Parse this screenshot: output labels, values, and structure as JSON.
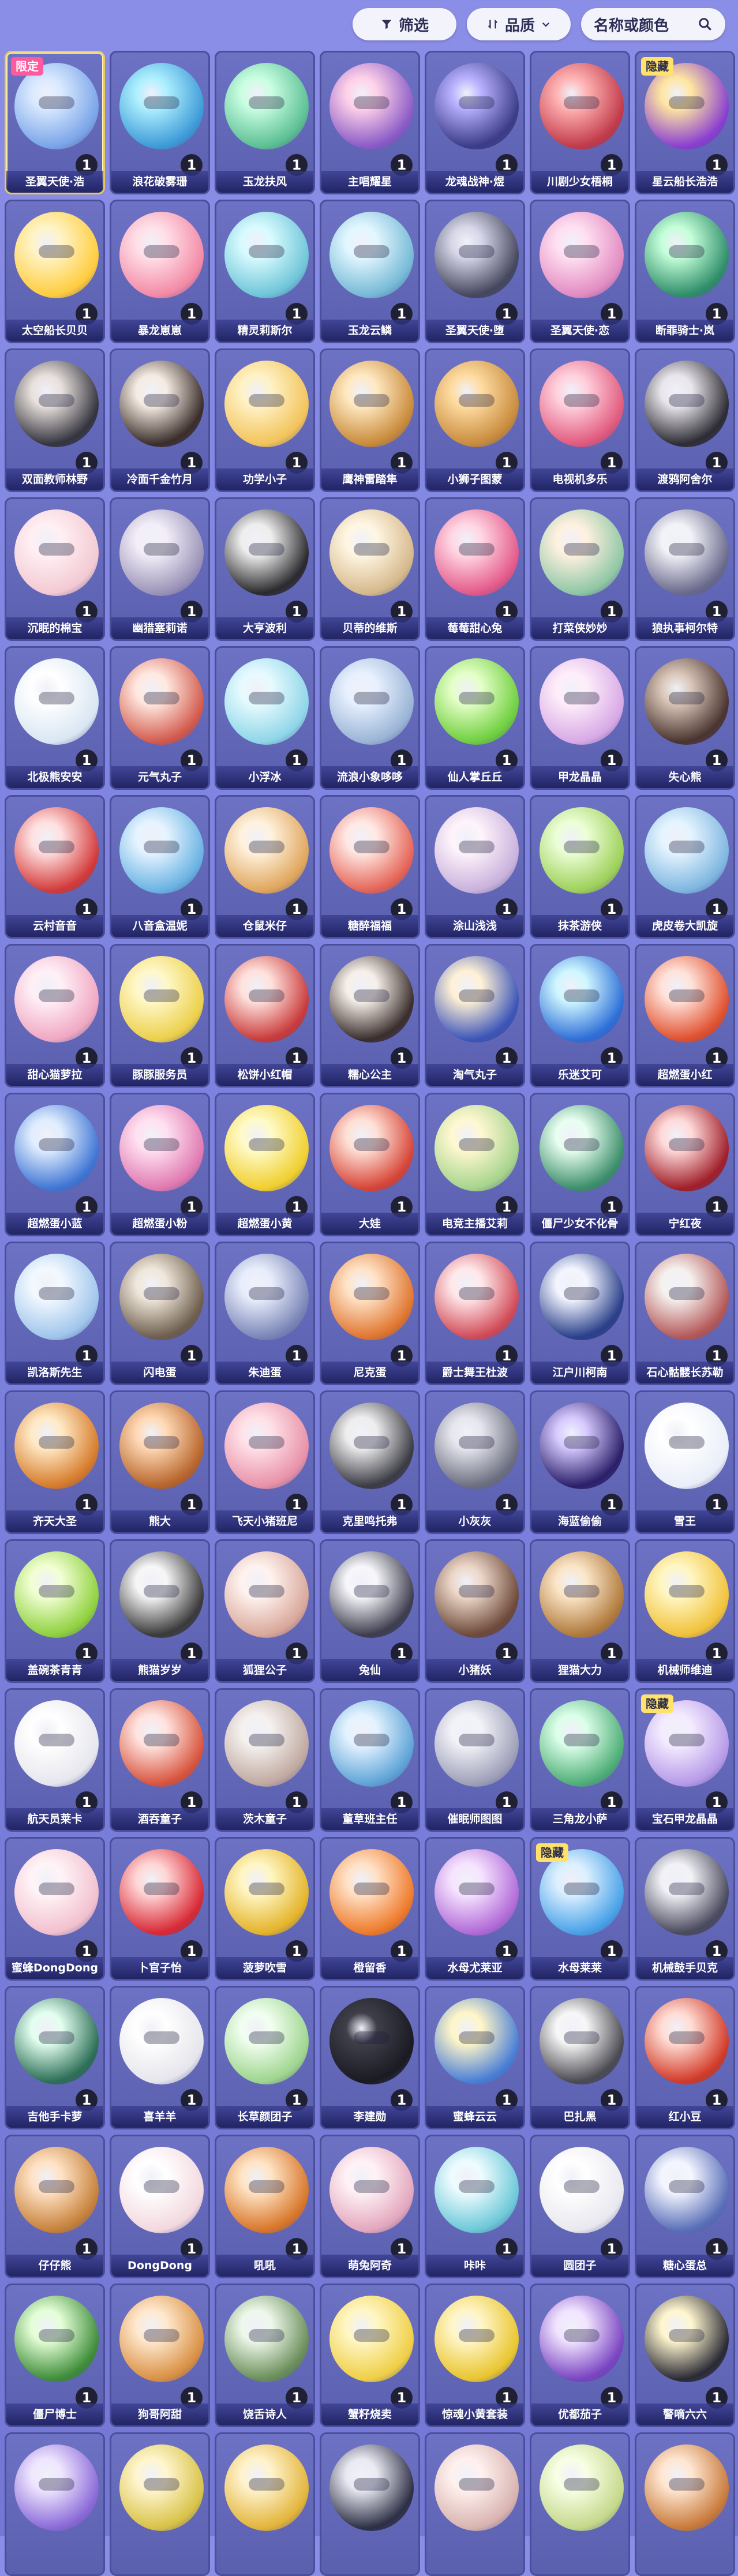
{
  "toolbar": {
    "filter_label": "筛选",
    "quality_label": "品质",
    "search_placeholder": "名称或颜色"
  },
  "cards": [
    {
      "name": "圣翼天使·浩",
      "count": "1",
      "tag": "限定",
      "c1": "#d9e9ff",
      "c2": "#7aa5e8"
    },
    {
      "name": "浪花破雾珊",
      "count": "1",
      "tag": "",
      "c1": "#aef0ff",
      "c2": "#3e9bd8"
    },
    {
      "name": "玉龙扶风",
      "count": "1",
      "tag": "",
      "c1": "#c9ffe2",
      "c2": "#5cbf94"
    },
    {
      "name": "主唱耀星",
      "count": "1",
      "tag": "",
      "c1": "#ffd1e8",
      "c2": "#8a5bc7"
    },
    {
      "name": "龙魂战神·煜",
      "count": "1",
      "tag": "",
      "c1": "#b7b0ff",
      "c2": "#3b3c88"
    },
    {
      "name": "川剧少女梧桐",
      "count": "1",
      "tag": "",
      "c1": "#ffb3b3",
      "c2": "#c23a4a"
    },
    {
      "name": "星云船长浩浩",
      "count": "1",
      "tag": "隐藏",
      "c1": "#ffe6a0",
      "c2": "#8a3fd1"
    },
    {
      "name": "太空船长贝贝",
      "count": "1",
      "tag": "",
      "c1": "#fff4c6",
      "c2": "#ffcc3d"
    },
    {
      "name": "暴龙崽崽",
      "count": "1",
      "tag": "",
      "c1": "#ffe0e8",
      "c2": "#f38aa6"
    },
    {
      "name": "精灵莉斯尔",
      "count": "1",
      "tag": "",
      "c1": "#d8fbff",
      "c2": "#6fc5d8"
    },
    {
      "name": "玉龙云鳞",
      "count": "1",
      "tag": "",
      "c1": "#e2f7ff",
      "c2": "#76b9d6"
    },
    {
      "name": "圣翼天使·堕",
      "count": "1",
      "tag": "",
      "c1": "#d6d6e8",
      "c2": "#45475e"
    },
    {
      "name": "圣翼天使·恋",
      "count": "1",
      "tag": "",
      "c1": "#ffe0f1",
      "c2": "#e28bc2"
    },
    {
      "name": "断罪骑士·岚",
      "count": "1",
      "tag": "",
      "c1": "#c4ffd9",
      "c2": "#2f8e6a"
    },
    {
      "name": "双面教师林野",
      "count": "1",
      "tag": "",
      "c1": "#e8e0dc",
      "c2": "#34343e"
    },
    {
      "name": "冷面千金竹月",
      "count": "1",
      "tag": "",
      "c1": "#f5ece3",
      "c2": "#3a2d2a"
    },
    {
      "name": "功学小子",
      "count": "1",
      "tag": "",
      "c1": "#fff2c6",
      "c2": "#f2c35a"
    },
    {
      "name": "鹰神雷踏隼",
      "count": "1",
      "tag": "",
      "c1": "#ffe9c2",
      "c2": "#c98a3a"
    },
    {
      "name": "小狮子图蒙",
      "count": "1",
      "tag": "",
      "c1": "#ffdca1",
      "c2": "#c88b3d"
    },
    {
      "name": "电视机多乐",
      "count": "1",
      "tag": "",
      "c1": "#ffd1de",
      "c2": "#e15a7d"
    },
    {
      "name": "渡鸦阿舍尔",
      "count": "1",
      "tag": "",
      "c1": "#e9e6ec",
      "c2": "#2d2b33"
    },
    {
      "name": "沉眠的棉宝",
      "count": "1",
      "tag": "",
      "c1": "#fff0f3",
      "c2": "#f3c9d3"
    },
    {
      "name": "幽猎塞莉诺",
      "count": "1",
      "tag": "",
      "c1": "#f3eef8",
      "c2": "#9c94b8"
    },
    {
      "name": "大亨波利",
      "count": "1",
      "tag": "",
      "c1": "#eeeeee",
      "c2": "#2a2a2e"
    },
    {
      "name": "贝蒂的维斯",
      "count": "1",
      "tag": "",
      "c1": "#fff7e3",
      "c2": "#d6b98c"
    },
    {
      "name": "莓莓甜心兔",
      "count": "1",
      "tag": "",
      "c1": "#ffd7e4",
      "c2": "#e45a8a"
    },
    {
      "name": "打菜侠妙妙",
      "count": "1",
      "tag": "",
      "c1": "#fff1e0",
      "c2": "#8fc7a5"
    },
    {
      "name": "狼执事柯尔特",
      "count": "1",
      "tag": "",
      "c1": "#f2f2f8",
      "c2": "#6a6a8c"
    },
    {
      "name": "北极熊安安",
      "count": "1",
      "tag": "",
      "c1": "#ffffff",
      "c2": "#d9e6f3"
    },
    {
      "name": "元气丸子",
      "count": "1",
      "tag": "",
      "c1": "#ffe9e0",
      "c2": "#d35a4d"
    },
    {
      "name": "小浮冰",
      "count": "1",
      "tag": "",
      "c1": "#e7fbff",
      "c2": "#8fd6e8"
    },
    {
      "name": "流浪小象哆哆",
      "count": "1",
      "tag": "",
      "c1": "#e8f1ff",
      "c2": "#9ab4d6"
    },
    {
      "name": "仙人掌丘丘",
      "count": "1",
      "tag": "",
      "c1": "#e4ffc7",
      "c2": "#6fcf3e"
    },
    {
      "name": "甲龙晶晶",
      "count": "1",
      "tag": "",
      "c1": "#ffeefa",
      "c2": "#d7a9e6"
    },
    {
      "name": "失心熊",
      "count": "1",
      "tag": "",
      "c1": "#d9c6b8",
      "c2": "#4a3430"
    },
    {
      "name": "云村音音",
      "count": "1",
      "tag": "",
      "c1": "#ffe0e0",
      "c2": "#d33a3a"
    },
    {
      "name": "八音盒温妮",
      "count": "1",
      "tag": "",
      "c1": "#e6f4ff",
      "c2": "#6ab3e3"
    },
    {
      "name": "仓鼠米仔",
      "count": "1",
      "tag": "",
      "c1": "#fff2de",
      "c2": "#e0a65c"
    },
    {
      "name": "糖醉福福",
      "count": "1",
      "tag": "",
      "c1": "#ffe9e4",
      "c2": "#e56457"
    },
    {
      "name": "涂山浅浅",
      "count": "1",
      "tag": "",
      "c1": "#fff4fb",
      "c2": "#c9b1dc"
    },
    {
      "name": "抹茶游侠",
      "count": "1",
      "tag": "",
      "c1": "#ecffd7",
      "c2": "#9ed05a"
    },
    {
      "name": "虎皮卷大凯旋",
      "count": "1",
      "tag": "",
      "c1": "#e4f4ff",
      "c2": "#7fb6e0"
    },
    {
      "name": "甜心猫萝拉",
      "count": "1",
      "tag": "",
      "c1": "#fff0f6",
      "c2": "#f0a7c3"
    },
    {
      "name": "豚豚服务员",
      "count": "1",
      "tag": "",
      "c1": "#fff8c9",
      "c2": "#ecd04b"
    },
    {
      "name": "松饼小红帽",
      "count": "1",
      "tag": "",
      "c1": "#ffe1dc",
      "c2": "#c93b3b"
    },
    {
      "name": "糯心公主",
      "count": "1",
      "tag": "",
      "c1": "#f6efe9",
      "c2": "#3a2e2c"
    },
    {
      "name": "淘气丸子",
      "count": "1",
      "tag": "",
      "c1": "#fff1d5",
      "c2": "#3c55b8"
    },
    {
      "name": "乐迷艾可",
      "count": "1",
      "tag": "",
      "c1": "#cff7ff",
      "c2": "#2e6fd8"
    },
    {
      "name": "超燃蛋小红",
      "count": "1",
      "tag": "",
      "c1": "#ffe2d9",
      "c2": "#e0502e"
    },
    {
      "name": "超燃蛋小蓝",
      "count": "1",
      "tag": "",
      "c1": "#e0edff",
      "c2": "#4076d4"
    },
    {
      "name": "超燃蛋小粉",
      "count": "1",
      "tag": "",
      "c1": "#ffe1f1",
      "c2": "#e07ab1"
    },
    {
      "name": "超燃蛋小黄",
      "count": "1",
      "tag": "",
      "c1": "#fffbc9",
      "c2": "#f0cf2e"
    },
    {
      "name": "大娃",
      "count": "1",
      "tag": "",
      "c1": "#ffe1d7",
      "c2": "#d64537"
    },
    {
      "name": "电竞主播艾莉",
      "count": "1",
      "tag": "",
      "c1": "#fff8d1",
      "c2": "#a6d48c"
    },
    {
      "name": "僵尸少女不化骨",
      "count": "1",
      "tag": "",
      "c1": "#e9fff1",
      "c2": "#3d8f6b"
    },
    {
      "name": "宁红夜",
      "count": "1",
      "tag": "",
      "c1": "#ffdada",
      "c2": "#a01f2a"
    },
    {
      "name": "凯洛斯先生",
      "count": "1",
      "tag": "",
      "c1": "#f3f9ff",
      "c2": "#9fc5ec"
    },
    {
      "name": "闪电蛋",
      "count": "1",
      "tag": "",
      "c1": "#efe7da",
      "c2": "#6e5e4e"
    },
    {
      "name": "朱迪蛋",
      "count": "1",
      "tag": "",
      "c1": "#e9eefc",
      "c2": "#7b86b8"
    },
    {
      "name": "尼克蛋",
      "count": "1",
      "tag": "",
      "c1": "#ffe3c7",
      "c2": "#e0752f"
    },
    {
      "name": "爵士舞王杜波",
      "count": "1",
      "tag": "",
      "c1": "#ffe8ea",
      "c2": "#d14b58"
    },
    {
      "name": "江户川柯南",
      "count": "1",
      "tag": "",
      "c1": "#f3f6ff",
      "c2": "#2a3f8a"
    },
    {
      "name": "石心骷髅长苏勒",
      "count": "1",
      "tag": "",
      "c1": "#f5f1ee",
      "c2": "#b45858"
    },
    {
      "name": "齐天大圣",
      "count": "1",
      "tag": "",
      "c1": "#ffeac6",
      "c2": "#d67b2a"
    },
    {
      "name": "熊大",
      "count": "1",
      "tag": "",
      "c1": "#ffd9b5",
      "c2": "#b8652b"
    },
    {
      "name": "飞天小猪班尼",
      "count": "1",
      "tag": "",
      "c1": "#ffe1e8",
      "c2": "#e891a8"
    },
    {
      "name": "克里鸣托弗",
      "count": "1",
      "tag": "",
      "c1": "#eeeeee",
      "c2": "#3b3b44"
    },
    {
      "name": "小灰灰",
      "count": "1",
      "tag": "",
      "c1": "#e6e6ee",
      "c2": "#6c6f80"
    },
    {
      "name": "海蓝偷偷",
      "count": "1",
      "tag": "",
      "c1": "#d6c9ff",
      "c2": "#2b1f6a"
    },
    {
      "name": "雪王",
      "count": "1",
      "tag": "",
      "c1": "#ffffff",
      "c2": "#e9eef8"
    },
    {
      "name": "盖碗茶青青",
      "count": "1",
      "tag": "",
      "c1": "#f2ffd4",
      "c2": "#8fd13e"
    },
    {
      "name": "熊猫岁岁",
      "count": "1",
      "tag": "",
      "c1": "#f7f7f7",
      "c2": "#3a3a3a"
    },
    {
      "name": "狐狸公子",
      "count": "1",
      "tag": "",
      "c1": "#fff3ef",
      "c2": "#d9a79a"
    },
    {
      "name": "兔仙",
      "count": "1",
      "tag": "",
      "c1": "#f7f7fb",
      "c2": "#3d3d4e"
    },
    {
      "name": "小猪妖",
      "count": "1",
      "tag": "",
      "c1": "#ecd7c9",
      "c2": "#6e4a3a"
    },
    {
      "name": "狸猫大力",
      "count": "1",
      "tag": "",
      "c1": "#fbe6c8",
      "c2": "#b07a3c"
    },
    {
      "name": "机械师维迪",
      "count": "1",
      "tag": "",
      "c1": "#fff7c4",
      "c2": "#f1c23a"
    },
    {
      "name": "航天员莱卡",
      "count": "1",
      "tag": "",
      "c1": "#ffffff",
      "c2": "#e6e6ee"
    },
    {
      "name": "酒吞童子",
      "count": "1",
      "tag": "",
      "c1": "#ffe4e0",
      "c2": "#d8553e"
    },
    {
      "name": "茨木童子",
      "count": "1",
      "tag": "",
      "c1": "#f4f1ef",
      "c2": "#c0a9a0"
    },
    {
      "name": "董草班主任",
      "count": "1",
      "tag": "",
      "c1": "#e4f3ff",
      "c2": "#5fa4d8"
    },
    {
      "name": "催眠师图图",
      "count": "1",
      "tag": "",
      "c1": "#f2f2f8",
      "c2": "#9ea0b8"
    },
    {
      "name": "三角龙小萨",
      "count": "1",
      "tag": "",
      "c1": "#dcffe9",
      "c2": "#4fae78"
    },
    {
      "name": "宝石甲龙晶晶",
      "count": "1",
      "tag": "隐藏",
      "c1": "#f4ecff",
      "c2": "#b79ae8"
    },
    {
      "name": "蜜蜂DongDong",
      "count": "1",
      "tag": "",
      "c1": "#fff4f7",
      "c2": "#f2c0cf"
    },
    {
      "name": "卜官子怡",
      "count": "1",
      "tag": "",
      "c1": "#ffd6d6",
      "c2": "#d82a35"
    },
    {
      "name": "菠萝吹雪",
      "count": "1",
      "tag": "",
      "c1": "#fff6c4",
      "c2": "#e4b42a"
    },
    {
      "name": "橙留香",
      "count": "1",
      "tag": "",
      "c1": "#ffe2c7",
      "c2": "#ee7a2a"
    },
    {
      "name": "水母尤莱亚",
      "count": "1",
      "tag": "",
      "c1": "#f6e4ff",
      "c2": "#b26bd8"
    },
    {
      "name": "水母莱莱",
      "count": "1",
      "tag": "隐藏",
      "c1": "#dcf0ff",
      "c2": "#4aa2e8"
    },
    {
      "name": "机械鼓手贝克",
      "count": "1",
      "tag": "",
      "c1": "#f1f1f6",
      "c2": "#4a4a5e"
    },
    {
      "name": "吉他手卡萝",
      "count": "1",
      "tag": "",
      "c1": "#e3fff0",
      "c2": "#2d6f57"
    },
    {
      "name": "喜羊羊",
      "count": "1",
      "tag": "",
      "c1": "#ffffff",
      "c2": "#e5e5ec"
    },
    {
      "name": "长草颜团子",
      "count": "1",
      "tag": "",
      "c1": "#f1fff0",
      "c2": "#9ed58e"
    },
    {
      "name": "李建勋",
      "count": "1",
      "tag": "",
      "c1": "#3f3f4a",
      "c2": "#1a1a22"
    },
    {
      "name": "蜜蜂云云",
      "count": "1",
      "tag": "",
      "c1": "#fff6c8",
      "c2": "#4a7fd6"
    },
    {
      "name": "巴扎黑",
      "count": "1",
      "tag": "",
      "c1": "#f7f7f7",
      "c2": "#4a4a52"
    },
    {
      "name": "红小豆",
      "count": "1",
      "tag": "",
      "c1": "#ffdcd4",
      "c2": "#d23a28"
    },
    {
      "name": "仔仔熊",
      "count": "1",
      "tag": "",
      "c1": "#ffe2c4",
      "c2": "#c6813a"
    },
    {
      "name": "DongDong",
      "count": "1",
      "tag": "",
      "c1": "#ffffff",
      "c2": "#f2d8df"
    },
    {
      "name": "吼吼",
      "count": "1",
      "tag": "",
      "c1": "#ffe4c4",
      "c2": "#d8762a"
    },
    {
      "name": "萌兔阿奇",
      "count": "1",
      "tag": "",
      "c1": "#fff2f6",
      "c2": "#e3a7bd"
    },
    {
      "name": "咔咔",
      "count": "1",
      "tag": "",
      "c1": "#eefcff",
      "c2": "#6cc8d8"
    },
    {
      "name": "圆团子",
      "count": "1",
      "tag": "",
      "c1": "#ffffff",
      "c2": "#e8e8ef"
    },
    {
      "name": "糖心蛋总",
      "count": "1",
      "tag": "",
      "c1": "#f4f6ff",
      "c2": "#5a6fb8"
    },
    {
      "name": "僵尸博士",
      "count": "1",
      "tag": "",
      "c1": "#e4ffd7",
      "c2": "#3f8d3a"
    },
    {
      "name": "狗哥阿甜",
      "count": "1",
      "tag": "",
      "c1": "#ffe9cf",
      "c2": "#d99043"
    },
    {
      "name": "饶舌诗人",
      "count": "1",
      "tag": "",
      "c1": "#eef8ea",
      "c2": "#6a8e5a"
    },
    {
      "name": "蟹籽烧卖",
      "count": "1",
      "tag": "",
      "c1": "#fff7c6",
      "c2": "#efcf45"
    },
    {
      "name": "惊魂小黄套装",
      "count": "1",
      "tag": "",
      "c1": "#fff6c8",
      "c2": "#e9c52e"
    },
    {
      "name": "优都茄子",
      "count": "1",
      "tag": "",
      "c1": "#f1e4ff",
      "c2": "#7a45c2"
    },
    {
      "name": "警嘀六六",
      "count": "1",
      "tag": "",
      "c1": "#fff6cf",
      "c2": "#2a2a34"
    },
    {
      "name": "",
      "count": "",
      "tag": "",
      "c1": "#efe6ff",
      "c2": "#8a6ad8"
    },
    {
      "name": "",
      "count": "",
      "tag": "",
      "c1": "#fff6cf",
      "c2": "#d8c247"
    },
    {
      "name": "",
      "count": "",
      "tag": "",
      "c1": "#fff3cc",
      "c2": "#e2b43a"
    },
    {
      "name": "",
      "count": "",
      "tag": "",
      "c1": "#e9eaf2",
      "c2": "#2d2f45"
    },
    {
      "name": "",
      "count": "",
      "tag": "",
      "c1": "#fff1ee",
      "c2": "#d8b3b0"
    },
    {
      "name": "",
      "count": "",
      "tag": "",
      "c1": "#f8ffe5",
      "c2": "#c4d88a"
    },
    {
      "name": "",
      "count": "",
      "tag": "",
      "c1": "#ffe7d2",
      "c2": "#c87a3a"
    }
  ]
}
